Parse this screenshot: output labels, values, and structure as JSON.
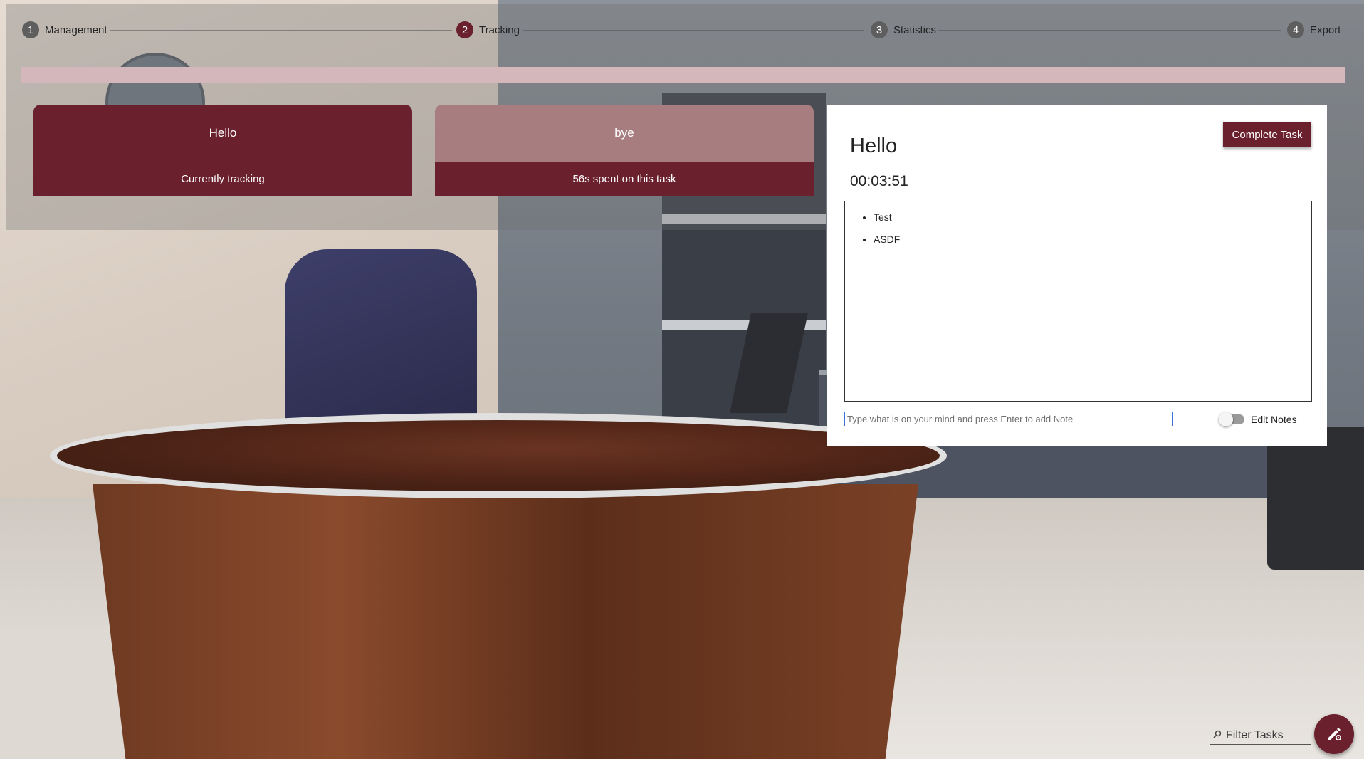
{
  "stepper": {
    "steps": [
      {
        "number": "1",
        "label": "Management"
      },
      {
        "number": "2",
        "label": "Tracking"
      },
      {
        "number": "3",
        "label": "Statistics"
      },
      {
        "number": "4",
        "label": "Export"
      }
    ],
    "active_step": 2
  },
  "progress": {
    "fraction": 0
  },
  "tasks": [
    {
      "title": "Hello",
      "status": "Currently tracking"
    },
    {
      "title": "bye",
      "status": "56s spent on this task"
    }
  ],
  "detail": {
    "title": "Hello",
    "timer": "00:03:51",
    "complete_label": "Complete Task",
    "notes": [
      "Test",
      "ASDF"
    ],
    "note_placeholder": "Type what is on your mind and press Enter to add Note",
    "edit_notes_label": "Edit Notes",
    "edit_notes_on": false
  },
  "filter": {
    "placeholder": "Filter Tasks"
  },
  "colors": {
    "accent": "#6b212d",
    "accent_light": "#a87d80",
    "progress_track": "#d4b7bb"
  },
  "icons": {
    "filter": "search-icon",
    "fab": "edit-settings-icon"
  }
}
